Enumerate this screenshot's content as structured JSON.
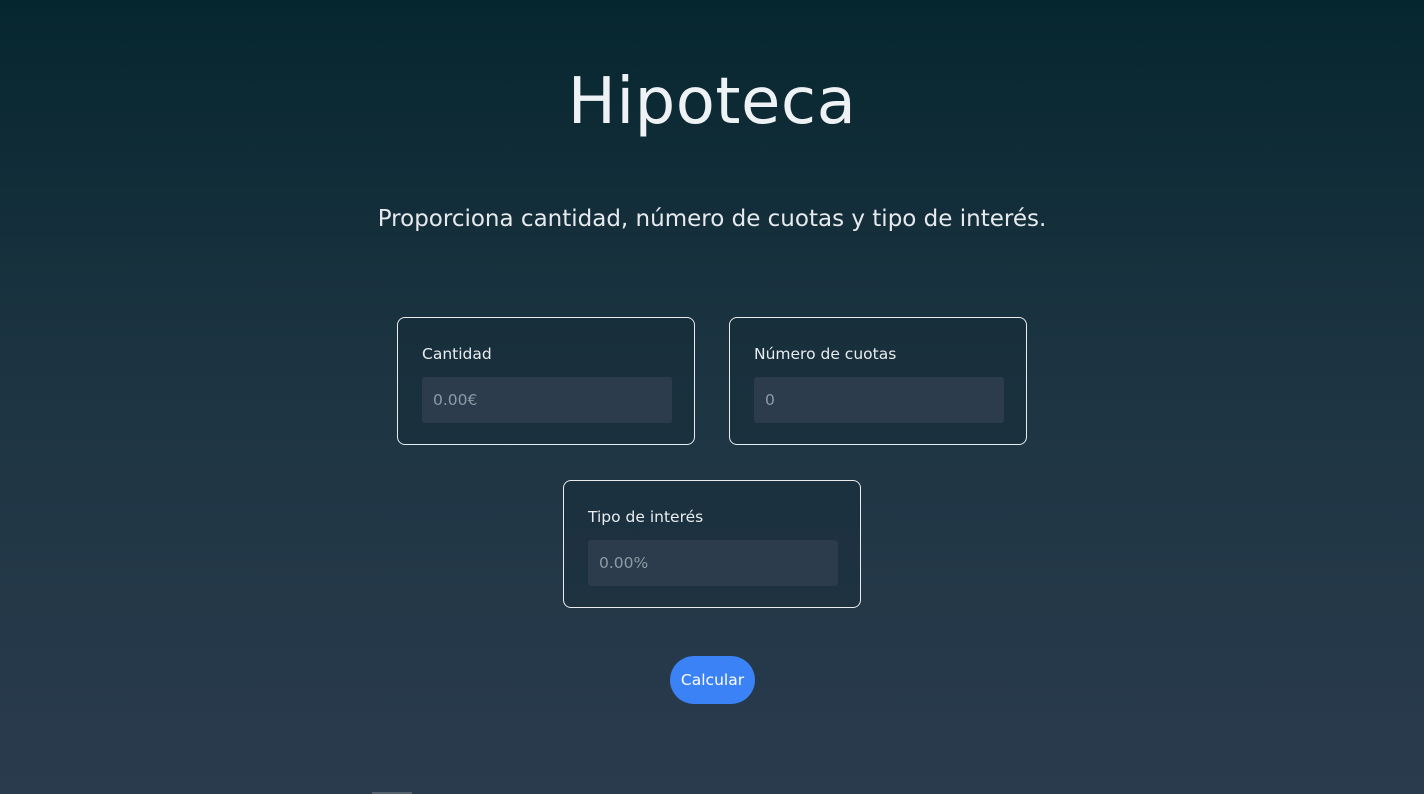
{
  "header": {
    "title": "Hipoteca",
    "subtitle": "Proporciona cantidad, número de cuotas y tipo de interés."
  },
  "form": {
    "cantidad": {
      "label": "Cantidad",
      "value": "",
      "placeholder": "0.00€"
    },
    "cuotas": {
      "label": "Número de cuotas",
      "value": "",
      "placeholder": "0"
    },
    "interes": {
      "label": "Tipo de interés",
      "value": "",
      "placeholder": "0.00%"
    },
    "submit_label": "Calcular"
  },
  "colors": {
    "accent": "#3b82f6",
    "background_top": "#06262f",
    "background_bottom": "#2a3b4e",
    "input_background": "#2c3c4d"
  }
}
